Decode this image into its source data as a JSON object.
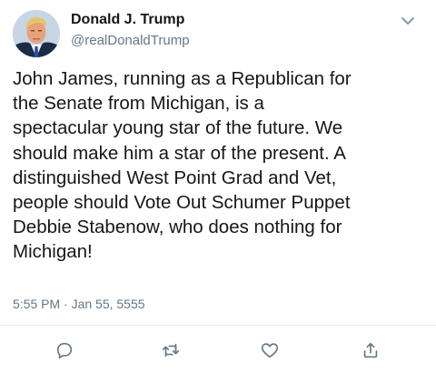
{
  "tweet": {
    "author_name": "Donald J. Trump",
    "handle": "@realDonaldTrump",
    "text": "John James, running as a Republican for\nthe Senate from Michigan, is a\nspectacular young star of the future. We\nshould make him a star of the present. A\ndistinguished West Point Grad and Vet,\npeople should Vote Out Schumer Puppet\nDebbie Stabenow, who does nothing for\nMichigan!",
    "timestamp": "5:55 PM · Jan 55, 5555"
  },
  "icons": {
    "menu": "chevron-down-icon",
    "actions": [
      "reply-icon",
      "retweet-icon",
      "like-icon",
      "share-icon"
    ]
  },
  "colors": {
    "text": "#14171a",
    "secondary": "#657786",
    "divider": "#e6ecf0"
  }
}
